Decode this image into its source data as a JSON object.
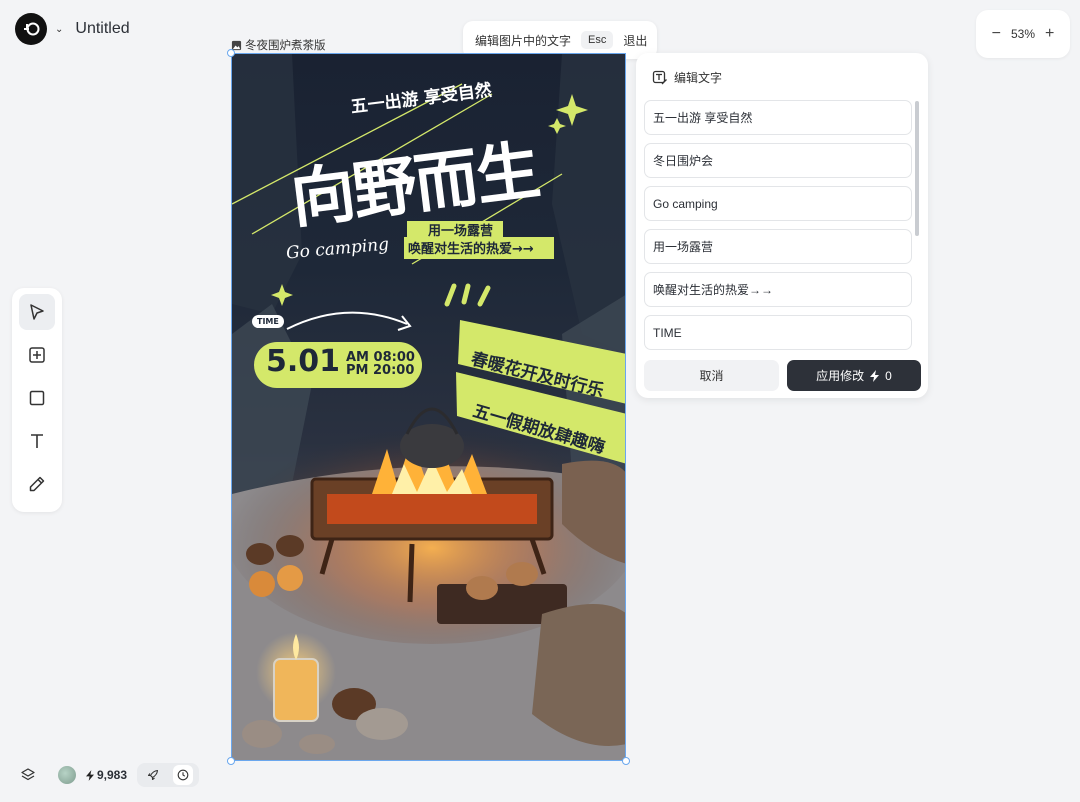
{
  "app": {
    "doc_title": "Untitled"
  },
  "zoom": {
    "minus": "−",
    "level": "53%",
    "plus": "+"
  },
  "edit_pill": {
    "label": "编辑图片中的文字",
    "esc": "Esc",
    "exit": "退出"
  },
  "canvas": {
    "image_name": "冬夜围炉煮茶版"
  },
  "poster": {
    "top_line": "五一出游 享受自然",
    "headline": "向野而生",
    "tag1": "用一场露营",
    "tag2": "唤醒对生活的热爱→→",
    "script_text": "Go camping",
    "time_badge": "TIME",
    "date": "5.01",
    "time_am": "AM 08:00",
    "time_pm": "PM 20:00",
    "banner1": "春暖花开及时行乐",
    "banner2": "五一假期放肆趣嗨"
  },
  "panel": {
    "title": "编辑文字",
    "items": [
      "五一出游 享受自然",
      "冬日围炉会",
      "Go camping",
      "用一场露营",
      "唤醒对生活的热爱→→",
      "TIME"
    ],
    "cancel": "取消",
    "apply": "应用修改",
    "apply_cost": "0"
  },
  "status": {
    "credits": "9,983"
  },
  "colors": {
    "accent_green": "#d4e86a",
    "dark_button": "#2d3139",
    "selection_blue": "#6aa7ee"
  }
}
